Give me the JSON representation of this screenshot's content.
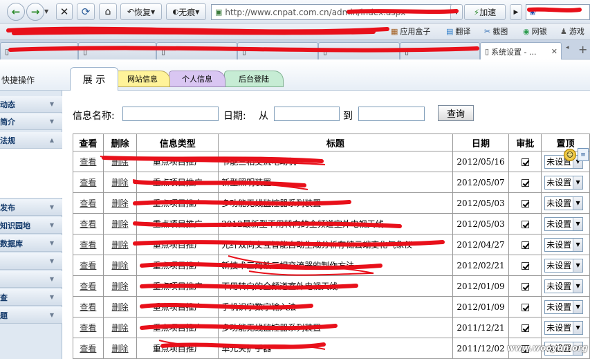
{
  "browser": {
    "back_label": "←",
    "forward_label": "→",
    "restore_label": "恢复",
    "incognito_label": "无痕",
    "address": "http://www.cnpat.com.cn/admin/index.aspx",
    "accelerate_label": "加速"
  },
  "bookmarks": [
    {
      "label": "应用盒子"
    },
    {
      "label": "翻译"
    },
    {
      "label": "截图"
    },
    {
      "label": "网银"
    },
    {
      "label": "游戏"
    }
  ],
  "tabs": {
    "active_title": "系统设置 - ..."
  },
  "header": {
    "quick_ops": "快捷操作",
    "panel_tabs": [
      {
        "label": "展 示",
        "color": "#ffffff"
      },
      {
        "label": "网站信息",
        "color": "#fff39a"
      },
      {
        "label": "个人信息",
        "color": "#d9c6f2"
      },
      {
        "label": "后台登陆",
        "color": "#c6ecd4"
      }
    ]
  },
  "sidebar": {
    "items": [
      {
        "label": "动态"
      },
      {
        "label": "简介"
      },
      {
        "label": "法规"
      },
      {
        "label": "发布"
      },
      {
        "label": "知识园地"
      },
      {
        "label": "数据库"
      },
      {
        "label": ""
      },
      {
        "label": ""
      },
      {
        "label": "查"
      },
      {
        "label": "题"
      }
    ]
  },
  "search": {
    "name_label": "信息名称:",
    "date_label": "日期:",
    "from_label": "从",
    "to_label": "到",
    "button_label": "查询"
  },
  "table": {
    "headers": [
      "查看",
      "删除",
      "信息类型",
      "标题",
      "日期",
      "审批",
      "置顶"
    ],
    "view_link": "查看",
    "delete_link": "删除",
    "select_value": "未设置",
    "rows": [
      {
        "type": "重点项目推广",
        "title": "节能三相交流电动机",
        "date": "2012/05/16"
      },
      {
        "type": "重点项目推广",
        "title": "新型照明装置",
        "date": "2012/05/07"
      },
      {
        "type": "重点项目推广",
        "title": "多功能无线监控器系列装置",
        "date": "2012/05/03"
      },
      {
        "type": "重点项目推广",
        "title": "2012最新型不用转向的全频道室外电视天线",
        "date": "2012/05/03"
      },
      {
        "type": "重点项目推广",
        "title": "光纤双向交互智能自动生成分析存储云端变化气象仪",
        "date": "2012/04/27"
      },
      {
        "type": "重点项目推广",
        "title": "新技术三角铁三相交流器的制作方法",
        "date": "2012/02/21"
      },
      {
        "type": "重点项目推广",
        "title": "不用转向的全频道室外电视天线",
        "date": "2012/01/09"
      },
      {
        "type": "重点项目推广",
        "title": "手机识字数字输入法",
        "date": "2012/01/09"
      },
      {
        "type": "重点项目推广",
        "title": "多功能无线监控器系列装置",
        "date": "2011/12/21"
      },
      {
        "type": "重点项目推广",
        "title": "单元夹扩手器",
        "date": "2011/12/02"
      }
    ]
  },
  "watermark": "www.wooyun.org"
}
